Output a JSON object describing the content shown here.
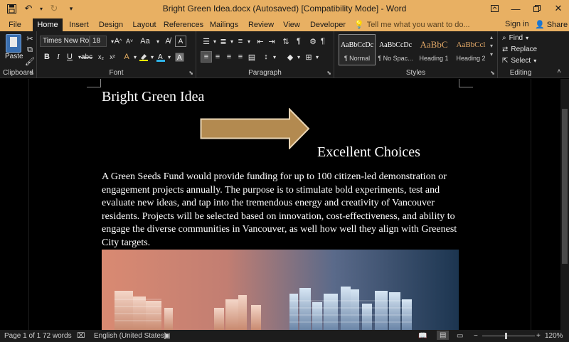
{
  "window": {
    "title": "Bright Green Idea.docx (Autosaved) [Compatibility Mode] - Word"
  },
  "tabs": [
    "File",
    "Home",
    "Insert",
    "Design",
    "Layout",
    "References",
    "Mailings",
    "Review",
    "View",
    "Developer"
  ],
  "active_tab": "Home",
  "tell_me": "Tell me what you want to do...",
  "account": {
    "sign_in": "Sign in",
    "share": "Share"
  },
  "ribbon": {
    "clipboard": {
      "paste": "Paste",
      "label": "Clipboard"
    },
    "font": {
      "name": "Times New Ro",
      "size": "18",
      "label": "Font"
    },
    "paragraph": {
      "label": "Paragraph"
    },
    "styles": {
      "label": "Styles",
      "items": [
        {
          "preview": "AaBbCcDc",
          "name": "¶ Normal"
        },
        {
          "preview": "AaBbCcDc",
          "name": "¶ No Spac..."
        },
        {
          "preview": "AaBbC",
          "name": "Heading 1"
        },
        {
          "preview": "AaBbCcl",
          "name": "Heading 2"
        }
      ]
    },
    "editing": {
      "label": "Editing",
      "find": "Find",
      "replace": "Replace",
      "select": "Select"
    }
  },
  "document": {
    "title": "Bright Green Idea",
    "subtitle": "Excellent Choices",
    "body": "A Green Seeds Fund would provide funding for up to 100 citizen-led demonstration or engagement projects annually. The purpose is to stimulate bold experiments, test and evaluate new ideas, and tap into the tremendous energy and creativity of Vancouver residents. Projects will be selected based on innovation, cost-effectiveness, and ability to engage the diverse communities in Vancouver, as well how well they align with Greenest City targets."
  },
  "status": {
    "page": "Page 1 of 1",
    "words": "72 words",
    "language": "English (United States)",
    "zoom": "120%"
  },
  "colors": {
    "title_bar": "#e8b063",
    "ribbon_bg": "#1c1c1c",
    "arrow_fill": "#b38a50",
    "heading_style": "#e2a867"
  }
}
